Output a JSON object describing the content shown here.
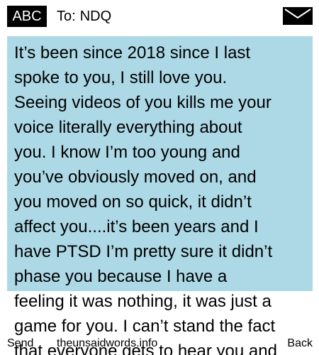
{
  "header": {
    "badge_label": "ABC",
    "to_prefix": "To:",
    "recipient": "NDQ",
    "envelope_icon": "envelope-icon"
  },
  "message": {
    "text": "It’s been since 2018 since I last\nspoke to you, I still love you.\nSeeing videos of you kills me your\nvoice literally everything about\nyou. I know I’m too young and\nyou’ve obviously moved on, and\nyou moved on so quick, it didn’t\naffect you....it’s been years and I\nhave PTSD I’m pretty sure it didn’t\nphase you because I have a\nfeeling it was nothing, it was just a\ngame for you. I can’t stand the fact\nthat everyone gets to hear you and",
    "highlight_color": "#add8e6"
  },
  "softkeys": {
    "left_label": "Send",
    "center_label": "theunsaidwords.info",
    "right_label": "Back"
  }
}
